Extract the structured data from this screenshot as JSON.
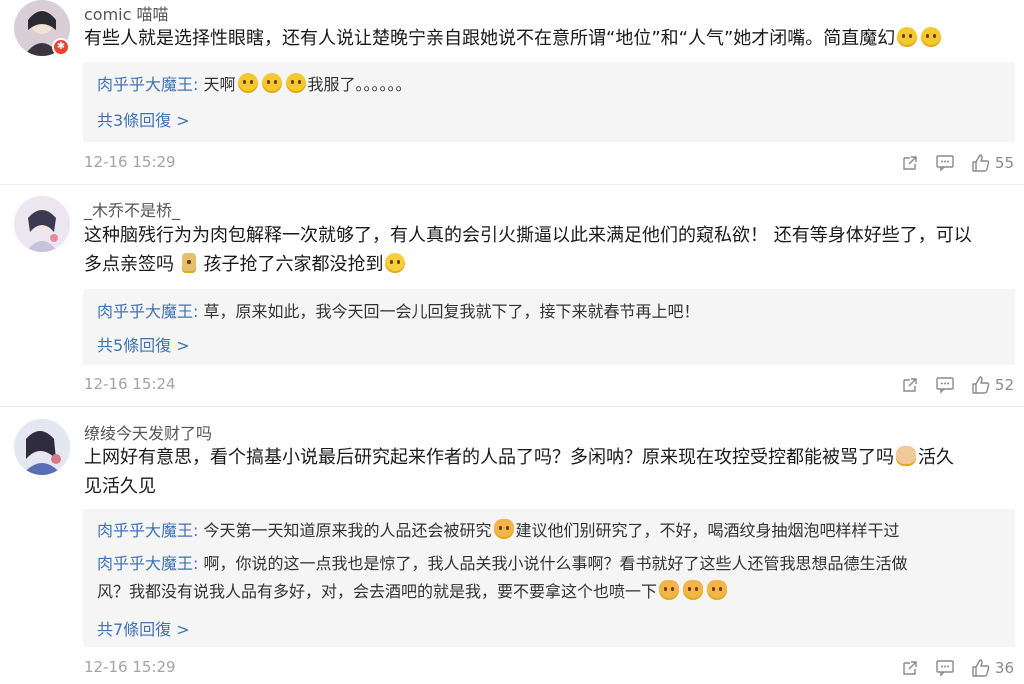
{
  "comments": [
    {
      "username": "comic 喵喵",
      "text_before": "有些人就是选择性眼瞎，还有人说让楚晚宁亲自跟她说不在意所谓“地位”和“人气”她才闭嘴。简直魔幻",
      "text_after": "",
      "line2": "",
      "line2_after": "",
      "replies": [
        {
          "author": "肉乎乎大魔王",
          "text": "天啊",
          "text_after": "我服了。。。。。。"
        }
      ],
      "more_label": "共3條回復 >",
      "time": "12-16 15:29",
      "likes": "55",
      "avatar_badge": "✱"
    },
    {
      "username": "_木乔不是桥_",
      "text_before": "这种脑残行为为肉包解释一次就够了，有人真的会引火撕逼以此来满足他们的窥私欲！ 还有等身体好些了，可以",
      "text_after": "",
      "line2": "多点亲签吗",
      "line2_mid": "孩子抢了六家都没抢到",
      "line2_after": "",
      "replies": [
        {
          "author": "肉乎乎大魔王",
          "text": "草，原来如此，我今天回一会儿回复我就下了，接下来就春节再上吧！",
          "text_after": ""
        }
      ],
      "more_label": "共5條回復 >",
      "time": "12-16 15:24",
      "likes": "52"
    },
    {
      "username": "缭绫今天发财了吗",
      "text_before": "上网好有意思，看个搞基小说最后研究起来作者的人品了吗？多闲呐？原来现在攻控受控都能被骂了吗",
      "text_after": "活久",
      "line2": "见活久见",
      "line2_after": "",
      "replies": [
        {
          "author": "肉乎乎大魔王",
          "text": "今天第一天知道原来我的人品还会被研究",
          "text_after": "建议他们别研究了，不好，喝酒纹身抽烟泡吧样样干过"
        },
        {
          "author": "肉乎乎大魔王",
          "text": "啊，你说的这一点我也是惊了，我人品关我小说什么事啊？看书就好了这些人还管我思想品德生活做",
          "text2": "风？我都没有说我人品有多好，对，会去酒吧的就是我，要不要拿这个也喷一下",
          "text_after": ""
        }
      ],
      "more_label": "共7條回復 >",
      "time": "12-16 15:29",
      "likes": "36"
    }
  ],
  "reply_colon": ": ",
  "colors": {
    "link": "#3f73b5",
    "text": "#1a1a1a",
    "meta": "#a3a3a3",
    "reply_bg": "#f5f5f5"
  },
  "icons": [
    "share-icon",
    "comment-icon",
    "like-icon",
    "emoji-icon"
  ]
}
